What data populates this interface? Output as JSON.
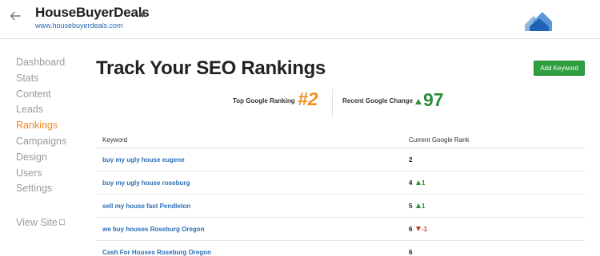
{
  "header": {
    "title": "HouseBuyerDeals",
    "url": "www.housebuyerdeals.com"
  },
  "sidebar": {
    "items": [
      {
        "label": "Dashboard",
        "active": false
      },
      {
        "label": "Stats",
        "active": false
      },
      {
        "label": "Content",
        "active": false
      },
      {
        "label": "Leads",
        "active": false
      },
      {
        "label": "Rankings",
        "active": true
      },
      {
        "label": "Campaigns",
        "active": false
      },
      {
        "label": "Design",
        "active": false
      },
      {
        "label": "Users",
        "active": false
      },
      {
        "label": "Settings",
        "active": false
      }
    ],
    "view_site": "View Site"
  },
  "main": {
    "title": "Track Your SEO Rankings",
    "add_button": "Add Keyword",
    "stats": {
      "top_ranking_label": "Top Google Ranking",
      "top_ranking_value": "#2",
      "recent_change_label": "Recent Google Change",
      "recent_change_value": "97",
      "recent_change_direction": "up"
    },
    "table": {
      "columns": [
        "Keyword",
        "Current Google Rank"
      ],
      "rows": [
        {
          "keyword": "buy my ugly house eugene",
          "rank": "2",
          "change": "",
          "direction": ""
        },
        {
          "keyword": "buy my ugly house roseburg",
          "rank": "4",
          "change": "1",
          "direction": "up"
        },
        {
          "keyword": "sell my house fast Pendleton",
          "rank": "5",
          "change": "1",
          "direction": "up"
        },
        {
          "keyword": "we buy houses Roseburg Oregon",
          "rank": "6",
          "change": "-1",
          "direction": "down"
        },
        {
          "keyword": "Cash For Houses Roseburg Oregon",
          "rank": "6",
          "change": "",
          "direction": ""
        }
      ]
    }
  },
  "colors": {
    "accent_orange": "#f08e1e",
    "positive_green": "#2e8b3b",
    "negative_red": "#c0392b",
    "link_blue": "#2d6fb5",
    "button_green": "#2f9e3e"
  },
  "icons": {
    "back": "arrow-left-icon",
    "dropdown": "chevron-down-icon",
    "logo": "houses-logo-icon",
    "external": "external-link-icon"
  }
}
